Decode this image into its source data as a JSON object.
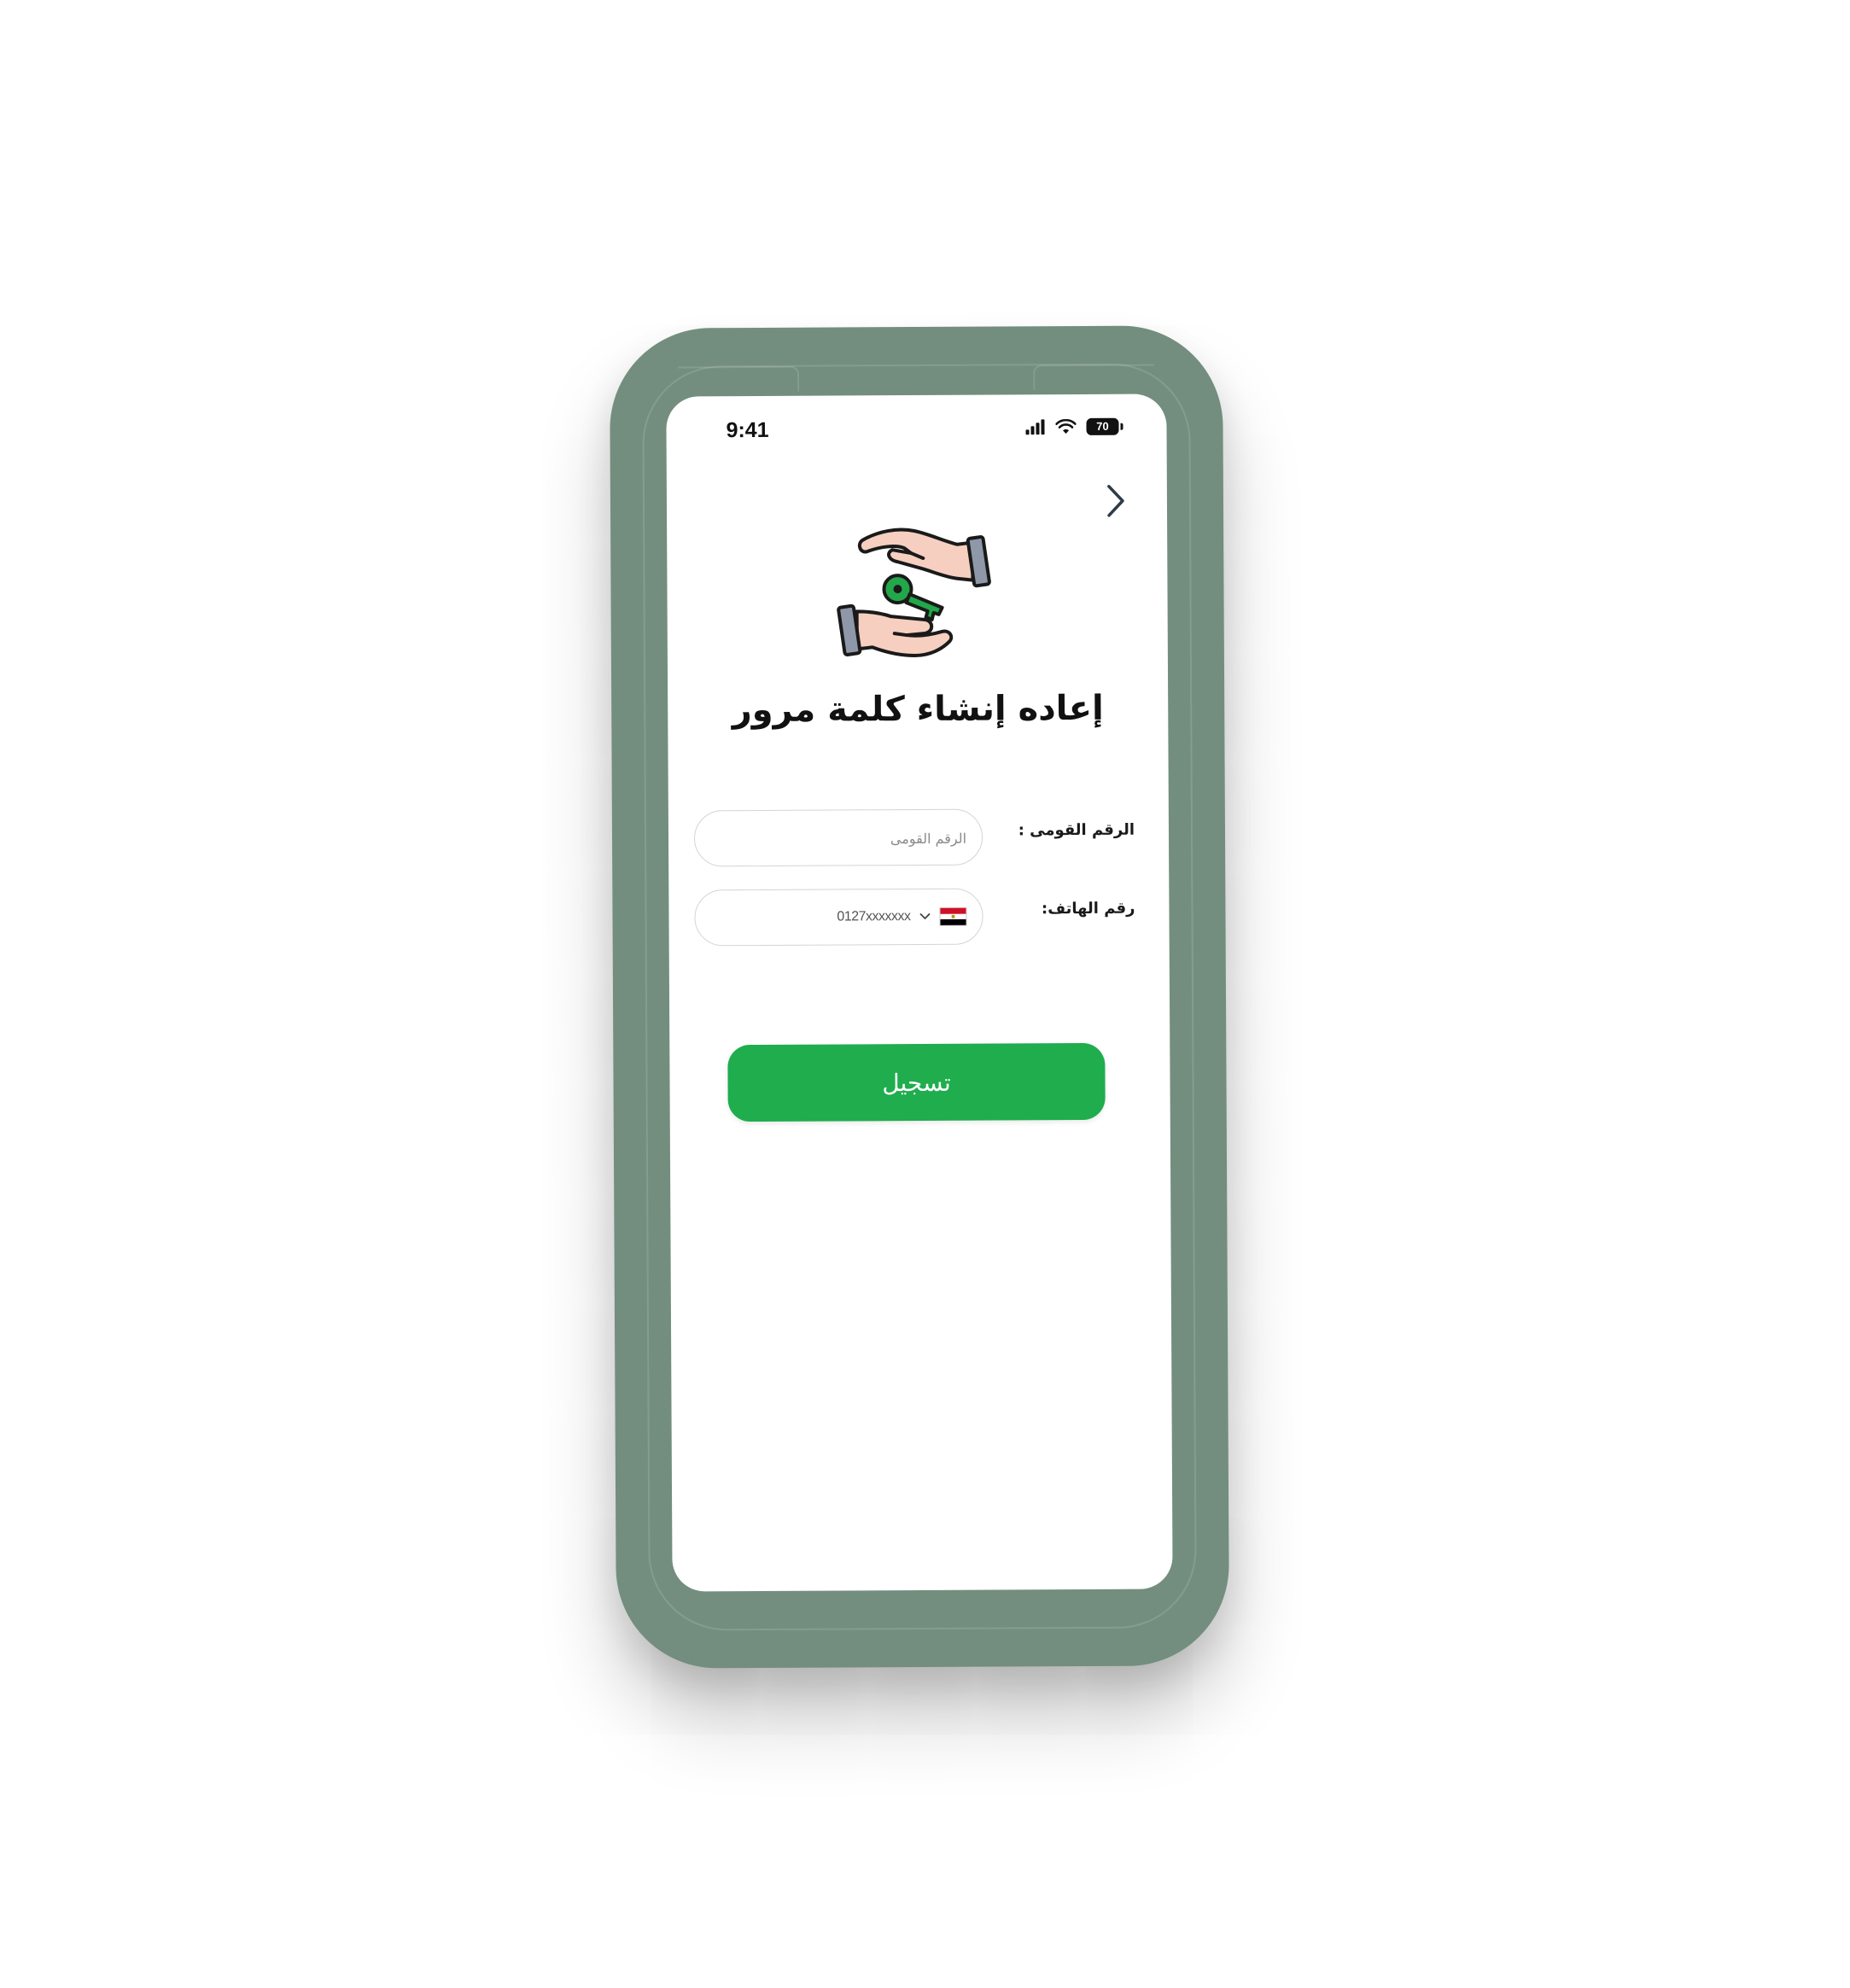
{
  "status_bar": {
    "time": "9:41",
    "battery": "70"
  },
  "icons": {
    "back": "chevron-right-icon",
    "illustration": "hands-key-icon",
    "signal": "cellular-signal-icon",
    "wifi": "wifi-icon",
    "battery": "battery-icon",
    "flag": "egypt-flag-icon",
    "dropdown": "chevron-down-icon"
  },
  "page": {
    "title": "إعاده إنشاء كلمة مرور"
  },
  "form": {
    "national_id": {
      "label": "الرقم القومى :",
      "placeholder": "الرقم القومى"
    },
    "phone": {
      "label": "رقم الهاتف:",
      "placeholder": "0127xxxxxxx"
    },
    "submit_label": "تسجيل"
  },
  "colors": {
    "case": "#738e7e",
    "primary_button": "#1fad4e",
    "key": "#22a74b"
  }
}
